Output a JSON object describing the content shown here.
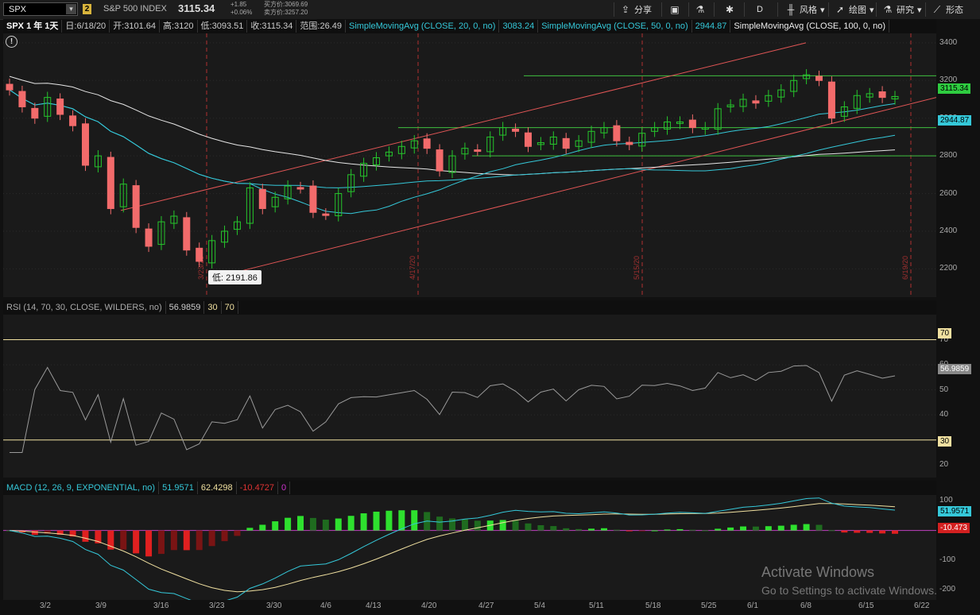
{
  "toolbar": {
    "symbol": "SPX",
    "badge": "2",
    "name": "S&P 500 INDEX",
    "last": "3115.34",
    "change": "+1.85",
    "change_pct": "+0.06%",
    "bid": "买方价:3069.69",
    "ask": "卖方价:3257.20",
    "share": "分享",
    "period": "D",
    "style": "风格",
    "draw": "绘图",
    "study": "研究",
    "pattern": "形态"
  },
  "price_header": {
    "title": "SPX 1 年 1天",
    "date": "日:6/18/20",
    "open": "开:3101.64",
    "high": "高:3120",
    "low": "低:3093.51",
    "close": "收:3115.34",
    "range": "范围:26.49",
    "sma20_label": "SimpleMovingAvg (CLOSE, 20, 0, no)",
    "sma20_val": "3083.24",
    "sma50_label": "SimpleMovingAvg (CLOSE, 50, 0, no)",
    "sma50_val": "2944.87",
    "sma100_label": "SimpleMovingAvg (CLOSE, 100, 0, no)"
  },
  "price_axis": [
    "3400",
    "3200",
    "3000",
    "2800",
    "2600",
    "2400",
    "2200"
  ],
  "price_tags": {
    "last": "3115.34",
    "sma50": "2944.87"
  },
  "low_callout": "低: 2191.86",
  "vert_markers": [
    "3/23/20",
    "4/17/20",
    "5/15/20",
    "6/19/20"
  ],
  "rsi": {
    "label": "RSI (14, 70, 30, CLOSE, WILDERS, no)",
    "value": "56.9859",
    "ob": "30",
    "os": "70",
    "axis": [
      "70",
      "60",
      "50",
      "40",
      "30",
      "20"
    ],
    "tag70": "70",
    "tag30": "30",
    "tagval": "56.9859"
  },
  "macd": {
    "label": "MACD (12, 26, 9, EXPONENTIAL, no)",
    "v1": "51.9571",
    "v2": "62.4298",
    "v3": "-10.4727",
    "v4": "0",
    "axis": [
      "100",
      "0",
      "-100",
      "-200"
    ],
    "tag1": "51.9571",
    "tag2": "-10.473"
  },
  "dates": [
    "3/2",
    "3/9",
    "3/16",
    "3/23",
    "3/30",
    "4/6",
    "4/13",
    "4/20",
    "4/27",
    "5/4",
    "5/11",
    "5/18",
    "5/25",
    "6/1",
    "6/8",
    "6/15",
    "6/22"
  ],
  "watermark": {
    "line1": "Activate Windows",
    "line2": "Go to Settings to activate Windows."
  },
  "colors": {
    "up": "#26c62c",
    "down": "#f26b6b",
    "sma": "#35c8d9",
    "sma100": "#e6e6e6",
    "trend": "#e05555",
    "hline": "#3fbf3f",
    "signal": "#f0e0a0"
  },
  "chart_data": {
    "type": "candlestick",
    "x_dates": [
      "3/2",
      "3/9",
      "3/16",
      "3/23",
      "3/30",
      "4/6",
      "4/13",
      "4/20",
      "4/27",
      "5/4",
      "5/11",
      "5/18",
      "5/25",
      "6/1",
      "6/8",
      "6/15",
      "6/22"
    ],
    "ylim": [
      2050,
      3450
    ],
    "closes_approx": [
      3150,
      3060,
      3000,
      3110,
      3020,
      2960,
      2750,
      2800,
      2520,
      2650,
      2420,
      2320,
      2450,
      2480,
      2300,
      2240,
      2350,
      2400,
      2450,
      2630,
      2520,
      2580,
      2640,
      2630,
      2500,
      2490,
      2600,
      2700,
      2760,
      2790,
      2820,
      2850,
      2880,
      2840,
      2720,
      2800,
      2840,
      2830,
      2900,
      2950,
      2930,
      2850,
      2870,
      2900,
      2840,
      2880,
      2930,
      2950,
      2880,
      2860,
      2920,
      2950,
      2980,
      2980,
      2950,
      2950,
      3050,
      3070,
      3100,
      3080,
      3120,
      3150,
      3200,
      3230,
      3200,
      3000,
      3060,
      3120,
      3130,
      3110,
      3115
    ],
    "low": 2191.86,
    "last": 3115.34,
    "sma20": 3083.24,
    "sma50": 2944.87,
    "rsi_last": 56.9859,
    "macd": 51.9571,
    "macd_signal": 62.4298,
    "macd_hist": -10.4727
  }
}
